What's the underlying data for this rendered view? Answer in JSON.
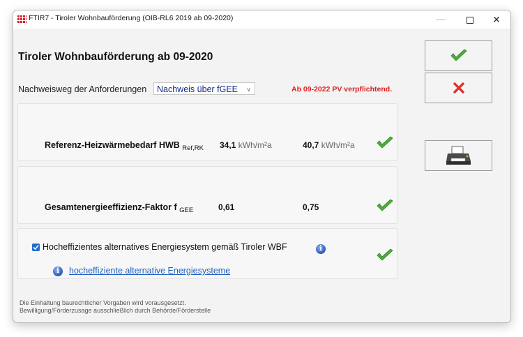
{
  "window": {
    "title": "FTIR7 - Tiroler Wohnbauförderung (OIB-RL6 2019 ab 09-2020)",
    "controls": {
      "minimize": "—",
      "close": "✕"
    }
  },
  "main": {
    "title": "Tiroler Wohnbauförderung ab 09-2020",
    "path_label": "Nachweisweg der Anforderungen",
    "path_select_value": "Nachweis über fGEE",
    "warning": "Ab 09-2022 PV verpflichtend."
  },
  "rows": [
    {
      "label": "Referenz-Heizwärmebedarf  HWB",
      "subscript": "Ref,RK",
      "value1": "34,1",
      "unit1": "kWh/m²a",
      "value2": "40,7",
      "unit2": "kWh/m²a",
      "status": "ok"
    },
    {
      "label": "Gesamtenergieeffizienz-Faktor  f",
      "subscript": "GEE",
      "value1": "0,61",
      "value2": "0,75",
      "status": "ok"
    }
  ],
  "option": {
    "checked": true,
    "label": "Hocheffizientes alternatives Energiesystem gemäß Tiroler WBF",
    "link": "hocheffiziente alternative Energiesysteme",
    "status": "ok"
  },
  "footer": {
    "line1": "Die Einhaltung baurechtlicher Vorgaben wird vorausgesetzt.",
    "line2": "Bewilligung/Förderzusage ausschließlich durch Behörde/Förderstelle"
  },
  "colors": {
    "accent": "#1e6fcf",
    "warning": "#e01e1e",
    "check": "#4caf3a",
    "cancel": "#e03030",
    "select_text": "#122b8a"
  },
  "icons": [
    "app-icon",
    "check-icon",
    "cancel-icon",
    "printer-icon",
    "info-icon"
  ]
}
